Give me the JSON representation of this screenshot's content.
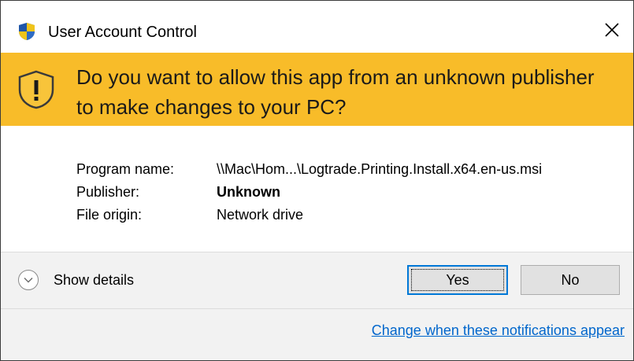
{
  "window": {
    "title": "User Account Control",
    "close_glyph": "✕"
  },
  "banner": {
    "question": "Do you want to allow this app from an unknown publisher to make changes to your PC?",
    "icon": "warning-shield-icon",
    "color": "#f8bc29"
  },
  "details": {
    "program_name_label": "Program name:",
    "program_name_value": "\\\\Mac\\Hom...\\Logtrade.Printing.Install.x64.en-us.msi",
    "publisher_label": "Publisher:",
    "publisher_value": "Unknown",
    "file_origin_label": "File origin:",
    "file_origin_value": "Network drive"
  },
  "footer": {
    "show_details_label": "Show details",
    "yes_label": "Yes",
    "no_label": "No",
    "notifications_link": "Change when these notifications appear"
  },
  "colors": {
    "banner": "#f8bc29",
    "footer_bg": "#f2f2f2",
    "link": "#0066cc",
    "focus_border": "#0078d7"
  }
}
